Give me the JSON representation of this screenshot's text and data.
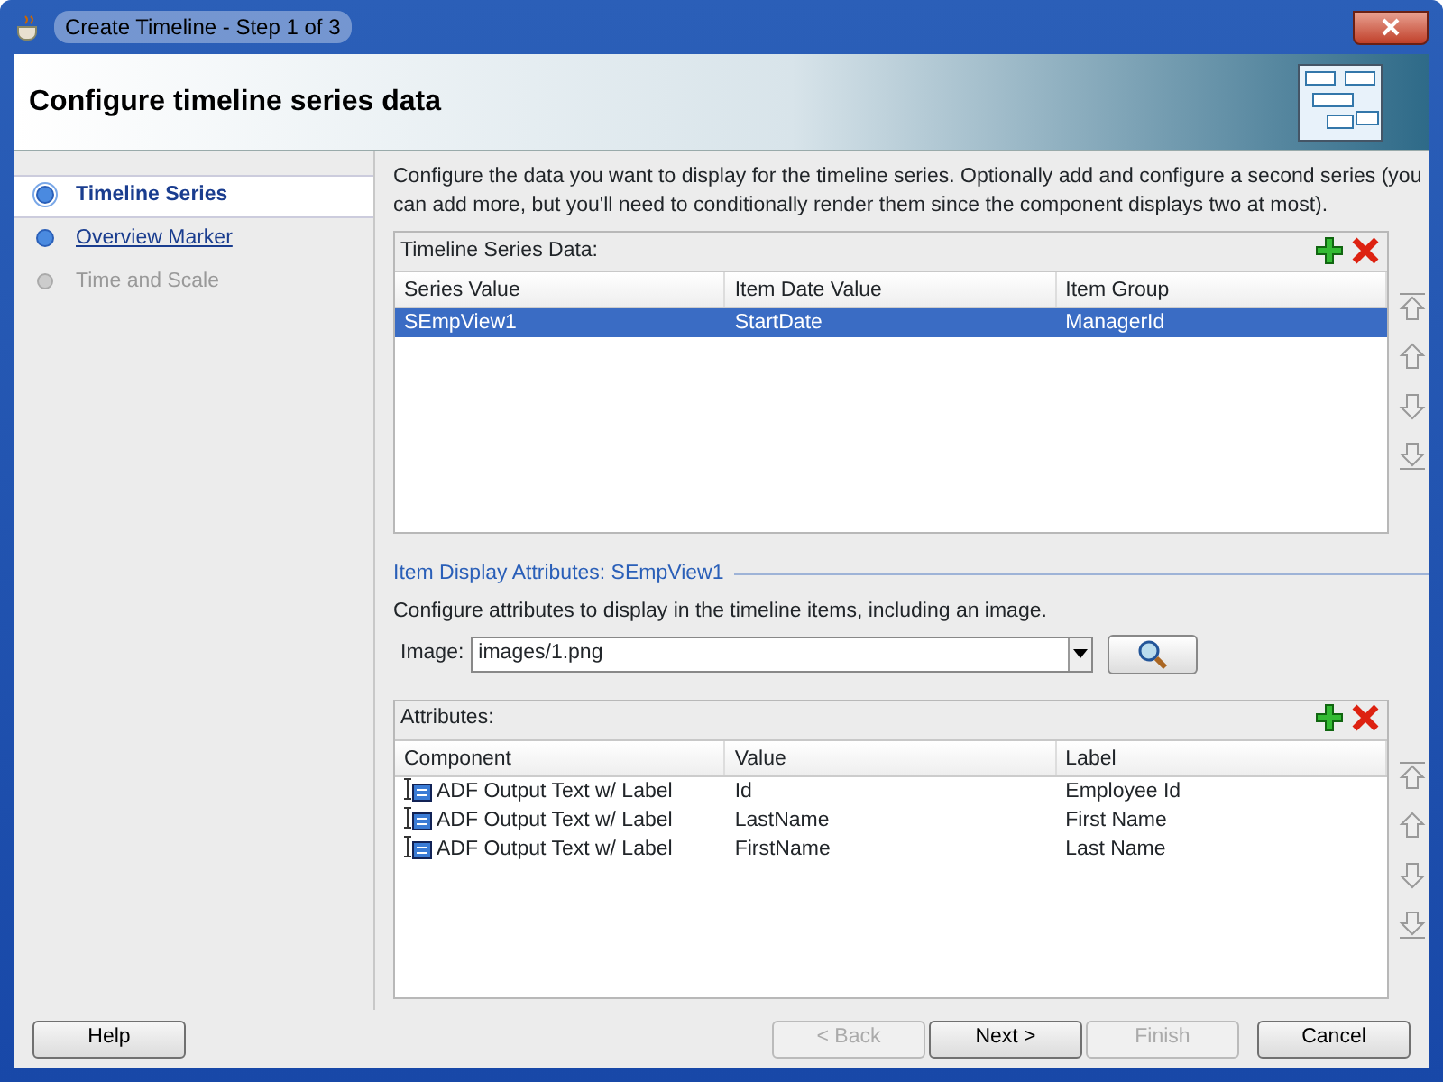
{
  "window": {
    "title": "Create Timeline - Step 1 of 3"
  },
  "header": {
    "title": "Configure timeline series data"
  },
  "steps": [
    {
      "label": "Timeline Series",
      "selected": true,
      "disabled": false
    },
    {
      "label": "Overview Marker",
      "selected": false,
      "disabled": false
    },
    {
      "label": "Time and Scale",
      "selected": false,
      "disabled": true
    }
  ],
  "intro": "Configure the data you want to display for the timeline series. Optionally add and configure a second series (you can add more, but you'll need to conditionally render them since the component displays two at most).",
  "series_table": {
    "title": "Timeline Series Data:",
    "columns": [
      "Series Value",
      "Item Date Value",
      "Item Group"
    ],
    "rows": [
      {
        "cells": [
          "SEmpView1",
          "StartDate",
          "ManagerId"
        ],
        "selected": true
      }
    ]
  },
  "item_display": {
    "heading": "Item Display Attributes: SEmpView1",
    "description": "Configure attributes to display in the timeline items, including an image.",
    "image_label": "Image:",
    "image_value": "images/1.png"
  },
  "attributes_table": {
    "title": "Attributes:",
    "columns": [
      "Component",
      "Value",
      "Label"
    ],
    "rows": [
      {
        "cells": [
          "ADF Output Text w/ Label",
          "Id",
          "Employee Id"
        ],
        "selected": false
      },
      {
        "cells": [
          "ADF Output Text w/ Label",
          "LastName",
          "First Name"
        ],
        "selected": false
      },
      {
        "cells": [
          "ADF Output Text w/ Label",
          "FirstName",
          "Last Name"
        ],
        "selected": false
      }
    ]
  },
  "help_button": {
    "label": "Help",
    "disabled": false
  },
  "nav_buttons": [
    {
      "label": "< Back",
      "disabled": true
    },
    {
      "label": "Next >",
      "disabled": false
    },
    {
      "label": "Finish",
      "disabled": true
    },
    {
      "label": "Cancel",
      "disabled": false
    }
  ]
}
